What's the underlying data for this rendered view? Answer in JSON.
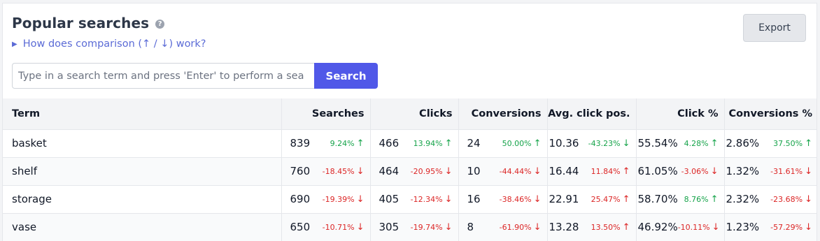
{
  "header": {
    "title": "Popular searches",
    "help_icon": "?",
    "comparison_link": "How does comparison (↑ / ↓) work?",
    "export_label": "Export"
  },
  "search": {
    "placeholder": "Type in a search term and press 'Enter' to perform a sea",
    "button_label": "Search"
  },
  "table": {
    "columns": [
      "Term",
      "Searches",
      "Clicks",
      "Conversions",
      "Avg. click pos.",
      "Click %",
      "Conversions %"
    ],
    "rows": [
      {
        "term": "basket",
        "searches": {
          "value": "839",
          "delta": "9.24%",
          "dir": "up"
        },
        "clicks": {
          "value": "466",
          "delta": "13.94%",
          "dir": "up"
        },
        "conversions": {
          "value": "24",
          "delta": "50.00%",
          "dir": "up"
        },
        "avg_click_pos": {
          "value": "10.36",
          "delta": "-43.23%",
          "dir": "down",
          "tone": "up"
        },
        "click_pct": {
          "value": "55.54%",
          "delta": "4.28%",
          "dir": "up"
        },
        "conversions_pct": {
          "value": "2.86%",
          "delta": "37.50%",
          "dir": "up"
        }
      },
      {
        "term": "shelf",
        "searches": {
          "value": "760",
          "delta": "-18.45%",
          "dir": "down"
        },
        "clicks": {
          "value": "464",
          "delta": "-20.95%",
          "dir": "down"
        },
        "conversions": {
          "value": "10",
          "delta": "-44.44%",
          "dir": "down"
        },
        "avg_click_pos": {
          "value": "16.44",
          "delta": "11.84%",
          "dir": "up",
          "tone": "down"
        },
        "click_pct": {
          "value": "61.05%",
          "delta": "-3.06%",
          "dir": "down"
        },
        "conversions_pct": {
          "value": "1.32%",
          "delta": "-31.61%",
          "dir": "down"
        }
      },
      {
        "term": "storage",
        "searches": {
          "value": "690",
          "delta": "-19.39%",
          "dir": "down"
        },
        "clicks": {
          "value": "405",
          "delta": "-12.34%",
          "dir": "down"
        },
        "conversions": {
          "value": "16",
          "delta": "-38.46%",
          "dir": "down"
        },
        "avg_click_pos": {
          "value": "22.91",
          "delta": "25.47%",
          "dir": "up",
          "tone": "down"
        },
        "click_pct": {
          "value": "58.70%",
          "delta": "8.76%",
          "dir": "up"
        },
        "conversions_pct": {
          "value": "2.32%",
          "delta": "-23.68%",
          "dir": "down"
        }
      },
      {
        "term": "vase",
        "searches": {
          "value": "650",
          "delta": "-10.71%",
          "dir": "down"
        },
        "clicks": {
          "value": "305",
          "delta": "-19.74%",
          "dir": "down"
        },
        "conversions": {
          "value": "8",
          "delta": "-61.90%",
          "dir": "down"
        },
        "avg_click_pos": {
          "value": "13.28",
          "delta": "13.50%",
          "dir": "up",
          "tone": "down"
        },
        "click_pct": {
          "value": "46.92%",
          "delta": "-10.11%",
          "dir": "down"
        },
        "conversions_pct": {
          "value": "1.23%",
          "delta": "-57.29%",
          "dir": "down"
        }
      }
    ]
  },
  "colors": {
    "accent": "#5058e8",
    "link": "#5b6bd6",
    "positive": "#16a34a",
    "negative": "#dc2626"
  }
}
